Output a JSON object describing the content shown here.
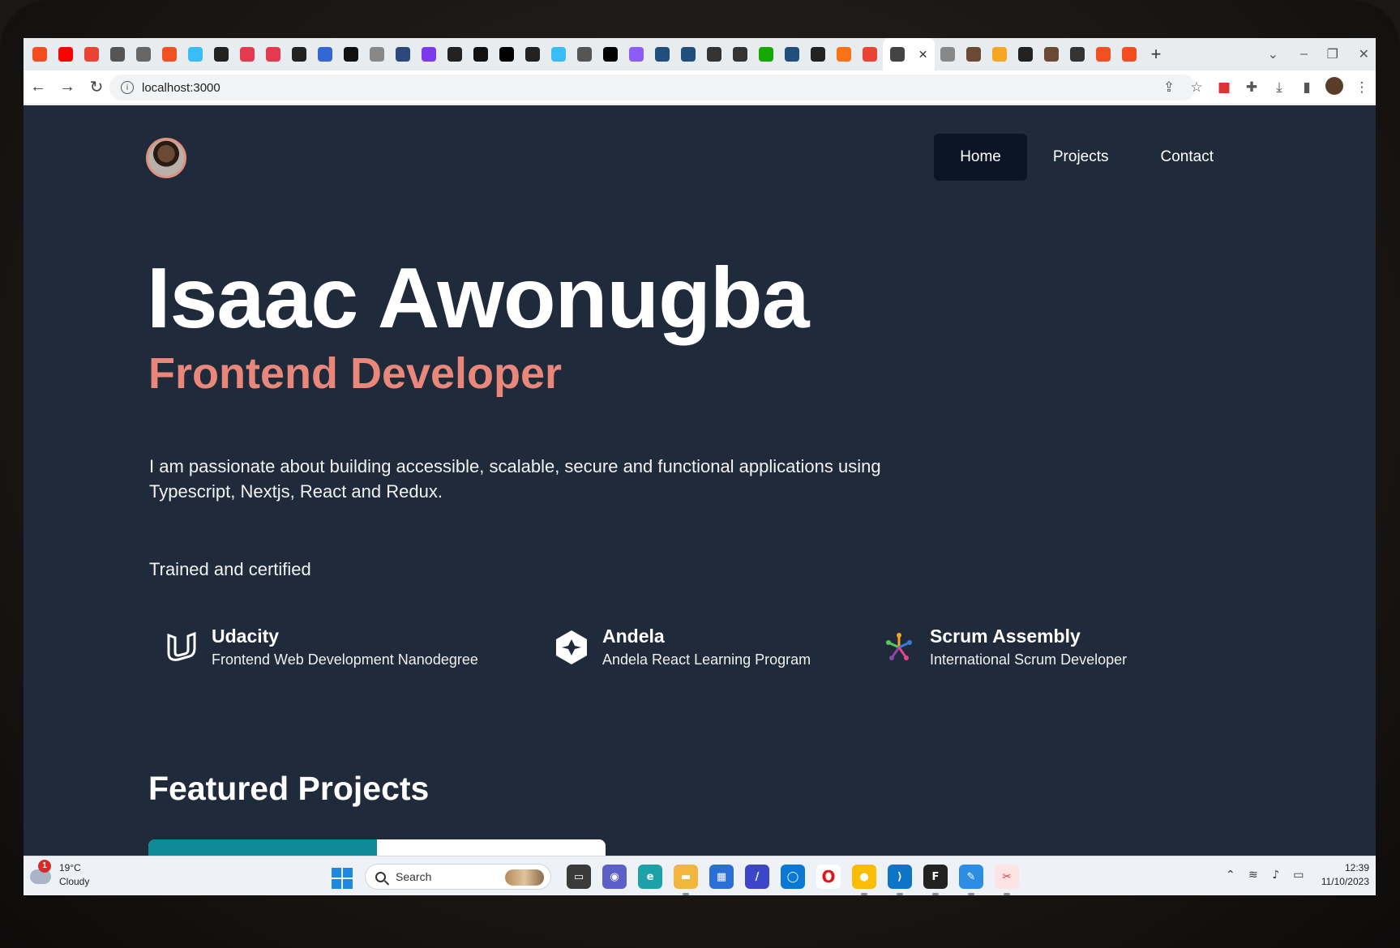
{
  "browser": {
    "tab_favicons": [
      {
        "icon": "figma-icon",
        "color": "#f24e1e"
      },
      {
        "icon": "youtube-icon",
        "color": "#ff0000"
      },
      {
        "icon": "gmail-icon",
        "color": "#ea4335"
      },
      {
        "icon": "graduation-cap-icon",
        "color": "#555555"
      },
      {
        "icon": "globe-icon",
        "color": "#666666"
      },
      {
        "icon": "microsoft-icon",
        "color": "#f25022"
      },
      {
        "icon": "tailwind-icon",
        "color": "#38bdf8"
      },
      {
        "icon": "github-icon",
        "color": "#222222"
      },
      {
        "icon": "record-icon",
        "color": "#e53950"
      },
      {
        "icon": "record-icon",
        "color": "#e53950"
      },
      {
        "icon": "github-icon",
        "color": "#222222"
      },
      {
        "icon": "devtools-icon",
        "color": "#3367d6"
      },
      {
        "icon": "medium-icon",
        "color": "#111111"
      },
      {
        "icon": "globe-icon",
        "color": "#888888"
      },
      {
        "icon": "globe-icon",
        "color": "#2b4a7a"
      },
      {
        "icon": "bootstrap-icon",
        "color": "#7c3aed"
      },
      {
        "icon": "github-icon",
        "color": "#222222"
      },
      {
        "icon": "ui-icon",
        "color": "#111111"
      },
      {
        "icon": "vercel-icon",
        "color": "#000000"
      },
      {
        "icon": "codepen-icon",
        "color": "#222222"
      },
      {
        "icon": "tailwind-icon",
        "color": "#38bdf8"
      },
      {
        "icon": "framer-icon",
        "color": "#555555"
      },
      {
        "icon": "nextjs-icon",
        "color": "#000000"
      },
      {
        "icon": "ublock-icon",
        "color": "#8b5cf6"
      },
      {
        "icon": "react-icon",
        "color": "#1f4f7a"
      },
      {
        "icon": "react-icon",
        "color": "#1f4f7a"
      },
      {
        "icon": "school-icon",
        "color": "#333333"
      },
      {
        "icon": "school-icon",
        "color": "#333333"
      },
      {
        "icon": "upwork-icon",
        "color": "#14a800"
      },
      {
        "icon": "react-icon",
        "color": "#1f4f7a"
      },
      {
        "icon": "calendar-icon",
        "color": "#222222"
      },
      {
        "icon": "g-icon",
        "color": "#f97316"
      },
      {
        "icon": "gmail-icon",
        "color": "#ea4335"
      },
      {
        "icon": "avatar-icon",
        "color": "#444444"
      },
      {
        "icon": "globe-icon",
        "color": "#888888"
      },
      {
        "icon": "profile-icon",
        "color": "#6b4a35"
      },
      {
        "icon": "r-icon",
        "color": "#f5a623"
      },
      {
        "icon": "github-icon",
        "color": "#222222"
      },
      {
        "icon": "profile-icon",
        "color": "#6b4a35"
      },
      {
        "icon": "drop-icon",
        "color": "#333333"
      },
      {
        "icon": "microsoft-icon",
        "color": "#f25022"
      },
      {
        "icon": "figma-icon",
        "color": "#f24e1e"
      }
    ],
    "url": "localhost:3000"
  },
  "site": {
    "nav": [
      "Home",
      "Projects",
      "Contact"
    ],
    "name": "Isaac Awonugba",
    "role": "Frontend Developer",
    "bio": "I am passionate about building accessible, scalable, secure and functional applications using Typescript, Nextjs, React and Redux.",
    "trained_heading": "Trained and certified",
    "certs": [
      {
        "org": "Udacity",
        "program": "Frontend Web Development Nanodegree",
        "icon": "udacity-icon"
      },
      {
        "org": "Andela",
        "program": "Andela React Learning Program",
        "icon": "andela-icon"
      },
      {
        "org": "Scrum Assembly",
        "program": "International Scrum Developer",
        "icon": "scrum-assembly-icon"
      }
    ],
    "featured_heading": "Featured Projects",
    "accent_color": "#e8877a",
    "bg_color": "#1f2a3b"
  },
  "taskbar": {
    "weather_badge": "1",
    "temperature": "19°C",
    "condition": "Cloudy",
    "search_placeholder": "Search",
    "time": "12:39",
    "date": "11/10/2023"
  }
}
